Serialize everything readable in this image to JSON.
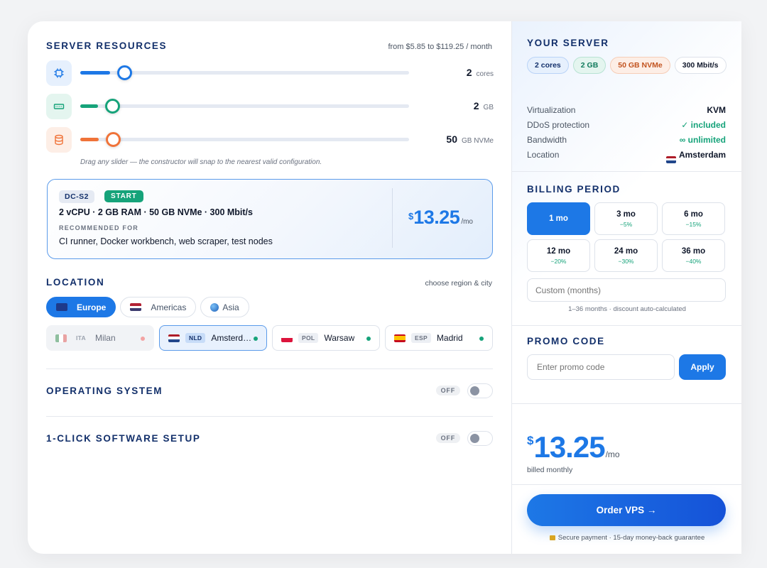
{
  "resources": {
    "title": "SERVER RESOURCES",
    "price_range": "from $5.85 to $119.25 / month",
    "cpu": {
      "value": "2",
      "unit": "cores",
      "level": 0.09
    },
    "ram": {
      "value": "2",
      "unit": "GB",
      "level": 0.055
    },
    "disk": {
      "value": "50",
      "unit": "GB NVMe",
      "level": 0.057
    },
    "hint": "Drag any slider — the constructor will snap to the nearest valid configuration.",
    "colors": {
      "cpu": "#1d78e6",
      "ram": "#16a37a",
      "disk": "#f07339"
    }
  },
  "plan": {
    "code": "DC-S2",
    "tag": "START",
    "spec": "2 vCPU · 2 GB RAM · 50 GB NVMe · 300 Mbit/s",
    "rec_label": "RECOMMENDED FOR",
    "use_cases": "CI runner, Docker workbench, web scraper, test nodes",
    "currency": "$",
    "price": "13.25",
    "per": "/mo"
  },
  "location": {
    "title": "LOCATION",
    "note": "choose region & city",
    "regions": [
      {
        "label": "Europe",
        "icon": "eu-flag-icon"
      },
      {
        "label": "Americas",
        "icon": "us-flag-icon"
      },
      {
        "label": "Asia",
        "icon": "globe-icon"
      }
    ],
    "cities": [
      {
        "code": "ITA",
        "name": "Milan",
        "status": "unavailable"
      },
      {
        "code": "NLD",
        "name": "Amsterdam",
        "status": "available"
      },
      {
        "code": "POL",
        "name": "Warsaw",
        "status": "available"
      },
      {
        "code": "ESP",
        "name": "Madrid",
        "status": "available"
      }
    ]
  },
  "os": {
    "title": "OPERATING SYSTEM",
    "state": "OFF"
  },
  "software": {
    "title": "1-CLICK SOFTWARE SETUP",
    "state": "OFF"
  },
  "summary": {
    "title": "YOUR SERVER",
    "chips": [
      "2 cores",
      "2 GB",
      "50 GB NVMe",
      "300 Mbit/s"
    ],
    "rows": [
      {
        "label": "Virtualization",
        "value": "KVM"
      },
      {
        "label": "DDoS protection",
        "value": "✓ included"
      },
      {
        "label": "Bandwidth",
        "value": "∞ unlimited"
      },
      {
        "label": "Location",
        "value": "Amsterdam"
      }
    ]
  },
  "billing": {
    "title": "BILLING PERIOD",
    "options": [
      {
        "label": "1 mo",
        "discount": ""
      },
      {
        "label": "3 mo",
        "discount": "−5%"
      },
      {
        "label": "6 mo",
        "discount": "−15%"
      },
      {
        "label": "12 mo",
        "discount": "−20%"
      },
      {
        "label": "24 mo",
        "discount": "−30%"
      },
      {
        "label": "36 mo",
        "discount": "−40%"
      }
    ],
    "custom_placeholder": "Custom (months)",
    "custom_note": "1–36 months · discount auto-calculated"
  },
  "promo": {
    "title": "PROMO CODE",
    "placeholder": "Enter promo code",
    "apply": "Apply"
  },
  "total": {
    "currency": "$",
    "price": "13.25",
    "per": "/mo",
    "billed": "billed monthly"
  },
  "order": {
    "label": "Order VPS →",
    "secure": "Secure payment · 15-day money-back guarantee"
  }
}
